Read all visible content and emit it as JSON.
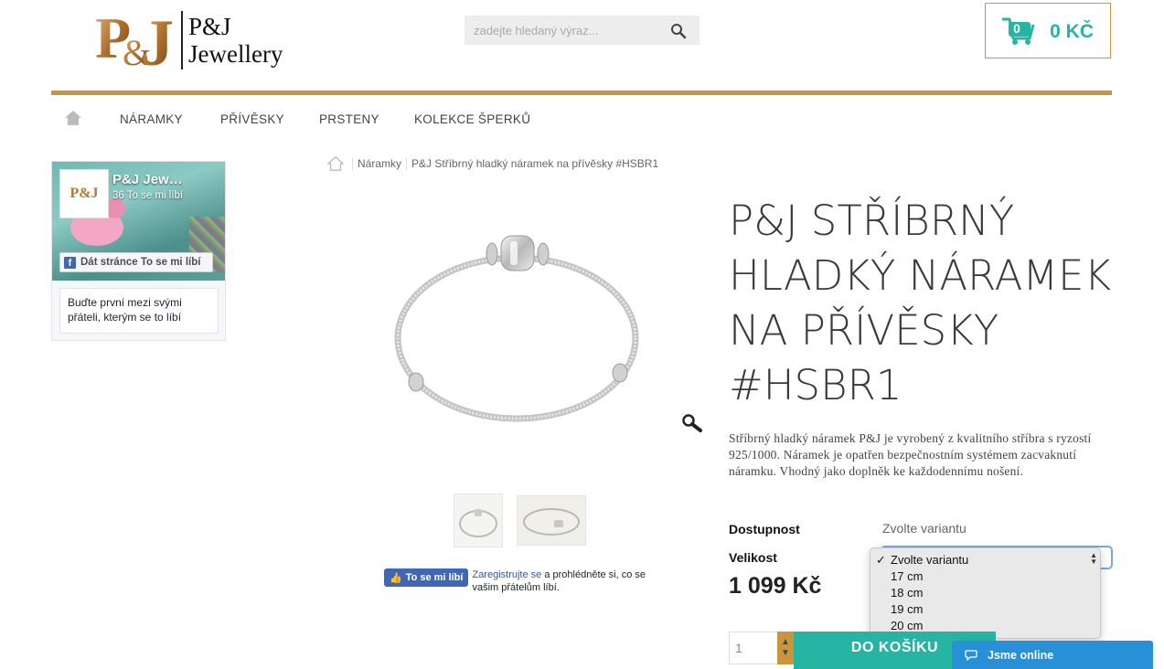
{
  "header": {
    "logo_text_line1": "P&J",
    "logo_text_line2": "Jewellery",
    "search_placeholder": "zadejte hledaný výraz...",
    "cart_count": "0",
    "cart_total": "0 KČ"
  },
  "nav": {
    "items": [
      "NÁRAMKY",
      "PŘÍVĚSKY",
      "PRSTENY",
      "KOLEKCE ŠPERKŮ"
    ]
  },
  "facebook_box": {
    "page_name": "P&J Jew…",
    "likes": "36 To se mi líbí",
    "like_button": "Dát stránce To se mi líbí",
    "friends_text": "Buďte první mezi svými přáteli, kterým se to líbí"
  },
  "breadcrumb": {
    "category": "Náramky",
    "current": "P&J Stříbrný hladký náramek na přívěsky #HSBR1"
  },
  "product": {
    "title": "P&J STŘÍBRNÝ HLADKÝ NÁRAMEK NA PŘÍVĚSKY #HSBR1",
    "description": "Stříbrný hladký náramek P&J je vyrobený z kvalitního stříbra s ryzostí 925/1000. Náramek je opatřen bezpečnostním systémem zacvaknutí náramku. Vhodný jako doplněk ke každodennímu nošení.",
    "availability_label": "Dostupnost",
    "availability_value": "Zvolte variantu",
    "size_label": "Velikost",
    "price": "1 099 Kč",
    "quantity": "1",
    "add_to_cart": "DO KOŠÍKU"
  },
  "size_dropdown": {
    "options": [
      "Zvolte variantu",
      "17 cm",
      "18 cm",
      "19 cm",
      "20 cm"
    ],
    "selected": "Zvolte variantu"
  },
  "fb_like": {
    "button": "To se mi líbí",
    "register_link": "Zaregistrujte se",
    "text": "a prohlédněte si, co se vašim přátelům líbí."
  },
  "chat": {
    "label": "Jsme online"
  },
  "colors": {
    "gold": "#c9963e",
    "teal": "#26b5a2",
    "chat_blue": "#2790d6"
  }
}
